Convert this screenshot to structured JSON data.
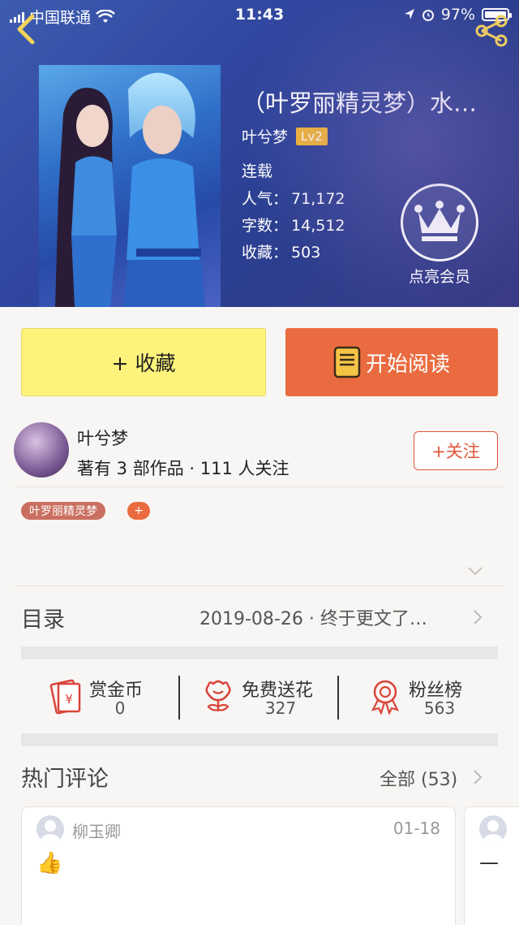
{
  "status_bar": {
    "carrier": "中国联通",
    "time": "11:43",
    "battery": "97%"
  },
  "book": {
    "title": "（叶罗丽精灵梦）水…",
    "author": "叶兮梦",
    "level": "Lv2",
    "status": "连载",
    "popularity_label": "人气：",
    "popularity": "71,172",
    "words_label": "字数：",
    "words": "14,512",
    "favorites_label": "收藏：",
    "favorites": "503"
  },
  "vip": {
    "label": "点亮会员"
  },
  "actions": {
    "favorite_label": "+ 收藏",
    "read_label": "开始阅读"
  },
  "author_block": {
    "name": "叶兮梦",
    "stats": "著有 3 部作品 · 111 人关注",
    "follow_label": "+关注"
  },
  "tags": [
    "叶罗丽精灵梦"
  ],
  "tag_add_label": "+",
  "toc": {
    "label": "目录",
    "latest": "2019-08-26 · 终于更文了…"
  },
  "stats": [
    {
      "label": "赏金币",
      "value": "0",
      "icon": "red-envelope-icon"
    },
    {
      "label": "免费送花",
      "value": "327",
      "icon": "flower-icon"
    },
    {
      "label": "粉丝榜",
      "value": "563",
      "icon": "medal-icon"
    }
  ],
  "comments": {
    "label": "热门评论",
    "all_label": "全部 (53)",
    "items": [
      {
        "user": "柳玉卿",
        "date": "01-18",
        "content": "👍"
      },
      {
        "user": "",
        "date": "",
        "content": "—"
      }
    ]
  },
  "colors": {
    "accent": "#ea6b3f",
    "favorite_button": "#fdf37b",
    "level_badge": "#f3b632",
    "header_bg": "#3147a0"
  }
}
